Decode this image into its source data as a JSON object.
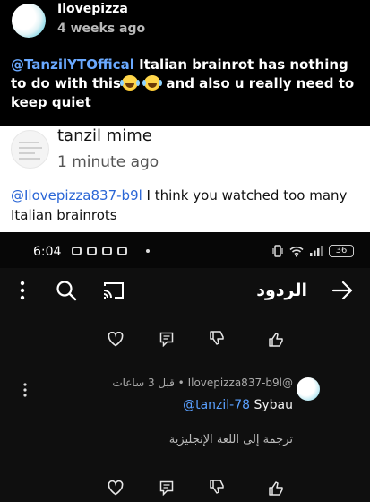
{
  "comment1": {
    "username": "Ilovepizza",
    "timestamp": "4 weeks ago",
    "mention": "@TanzilYTOffical",
    "text_part1": " Italian brainrot has nothing to do with this",
    "text_part2": " and also u really need to keep quiet",
    "emoji_name": "laughing-tears"
  },
  "comment2": {
    "username": "tanzil mime",
    "timestamp": "1 minute ago",
    "mention": "@Ilovepizza837-b9l",
    "text": " I think you watched too many Italian brainrots"
  },
  "phone": {
    "status": {
      "time": "6:04",
      "battery": "36"
    },
    "header": {
      "title": "الردود"
    },
    "reply": {
      "author": "@Ilovepizza837-b9l",
      "time": "قبل 3 ساعات",
      "separator": " • ",
      "mention": "@tanzil-78",
      "text": " Sybau",
      "translate": "ترجمة إلى اللغة الإنجليزية"
    }
  },
  "colors": {
    "mention_dark": "#6aa9ff",
    "mention_light": "#2a66d6",
    "background_dark": "#000000"
  }
}
